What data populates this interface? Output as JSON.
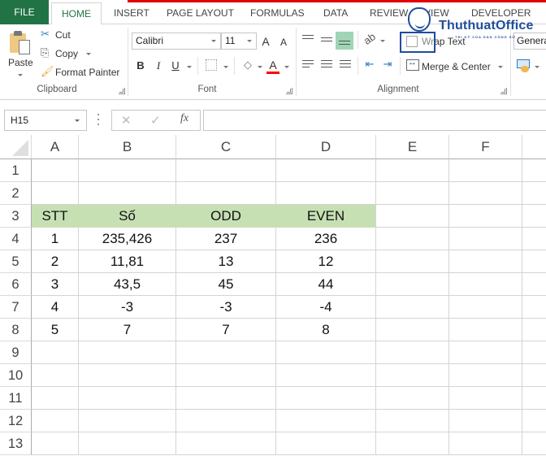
{
  "tabs": [
    {
      "id": "file",
      "label": "FILE"
    },
    {
      "id": "home",
      "label": "HOME",
      "active": true
    },
    {
      "id": "insert",
      "label": "INSERT"
    },
    {
      "id": "pagelayout",
      "label": "PAGE LAYOUT"
    },
    {
      "id": "formulas",
      "label": "FORMULAS"
    },
    {
      "id": "data",
      "label": "DATA"
    },
    {
      "id": "review",
      "label": "REVIEW"
    },
    {
      "id": "view",
      "label": "VIEW"
    },
    {
      "id": "developer",
      "label": "DEVELOPER"
    }
  ],
  "ribbon": {
    "clipboard": {
      "group_label": "Clipboard",
      "paste": "Paste",
      "cut": "Cut",
      "copy": "Copy",
      "format_painter": "Format Painter"
    },
    "font": {
      "group_label": "Font",
      "font_name": "Calibri",
      "font_size": "11",
      "bold": "B",
      "italic": "I",
      "underline": "U",
      "grow": "A",
      "shrink": "A",
      "font_color_letter": "A",
      "font_color": "#ff0000"
    },
    "alignment": {
      "group_label": "Alignment",
      "wrap_text": "Wrap Text",
      "merge_center": "Merge & Center"
    },
    "number": {
      "format": "General"
    }
  },
  "watermark": {
    "brand": "ThuthuatOffice",
    "tagline": "TRI KỶ CỦA DÂN CÔNG SỞ"
  },
  "formula_bar": {
    "name_box": "H15",
    "cancel_icon": "✕",
    "enter_icon": "✓",
    "fx_label": "fx",
    "formula": ""
  },
  "sheet": {
    "columns": [
      "A",
      "B",
      "C",
      "D",
      "E",
      "F"
    ],
    "rows": [
      "1",
      "2",
      "3",
      "4",
      "5",
      "6",
      "7",
      "8",
      "9",
      "10",
      "11",
      "12",
      "13"
    ],
    "header_fill": "#c6e0b4",
    "table": {
      "headers": [
        "STT",
        "Số",
        "ODD",
        "EVEN"
      ],
      "data": [
        [
          "1",
          "235,426",
          "237",
          "236"
        ],
        [
          "2",
          "11,81",
          "13",
          "12"
        ],
        [
          "3",
          "43,5",
          "45",
          "44"
        ],
        [
          "4",
          "-3",
          "-3",
          "-4"
        ],
        [
          "5",
          "7",
          "7",
          "8"
        ]
      ]
    }
  }
}
